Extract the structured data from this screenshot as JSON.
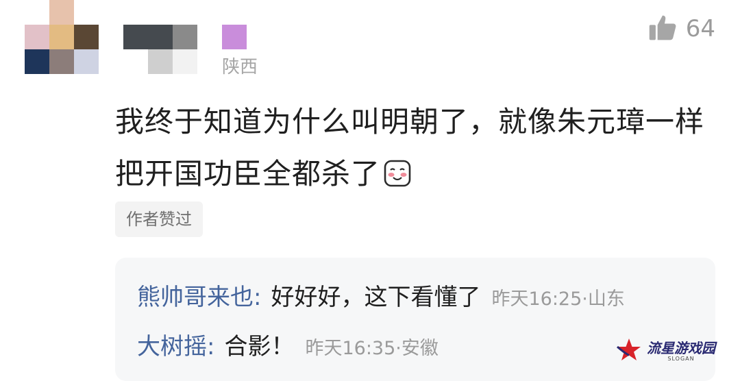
{
  "comment": {
    "location": "陕西",
    "like_count": "64",
    "text": "我终于知道为什么叫明朝了，就像朱元璋一样把开国功臣全都杀了",
    "author_liked_badge": "作者赞过"
  },
  "replies": [
    {
      "user": "熊帅哥来也",
      "colon": ":",
      "text": "好好好，这下看懂了",
      "meta": "昨天16:25·山东"
    },
    {
      "user": "大树摇",
      "colon": ":",
      "text": "合影！",
      "meta": "昨天16:35·安徽"
    }
  ],
  "watermark": {
    "title": "流星游戏园",
    "slogan": "SLOGAN"
  },
  "colors": {
    "username_blue": "#44649c",
    "muted_gray": "#9a9a9a",
    "reply_bg": "#f6f7f8"
  },
  "icons": {
    "like": "thumbs-up-icon",
    "emoji": "blushing-smile-emoji-icon"
  }
}
